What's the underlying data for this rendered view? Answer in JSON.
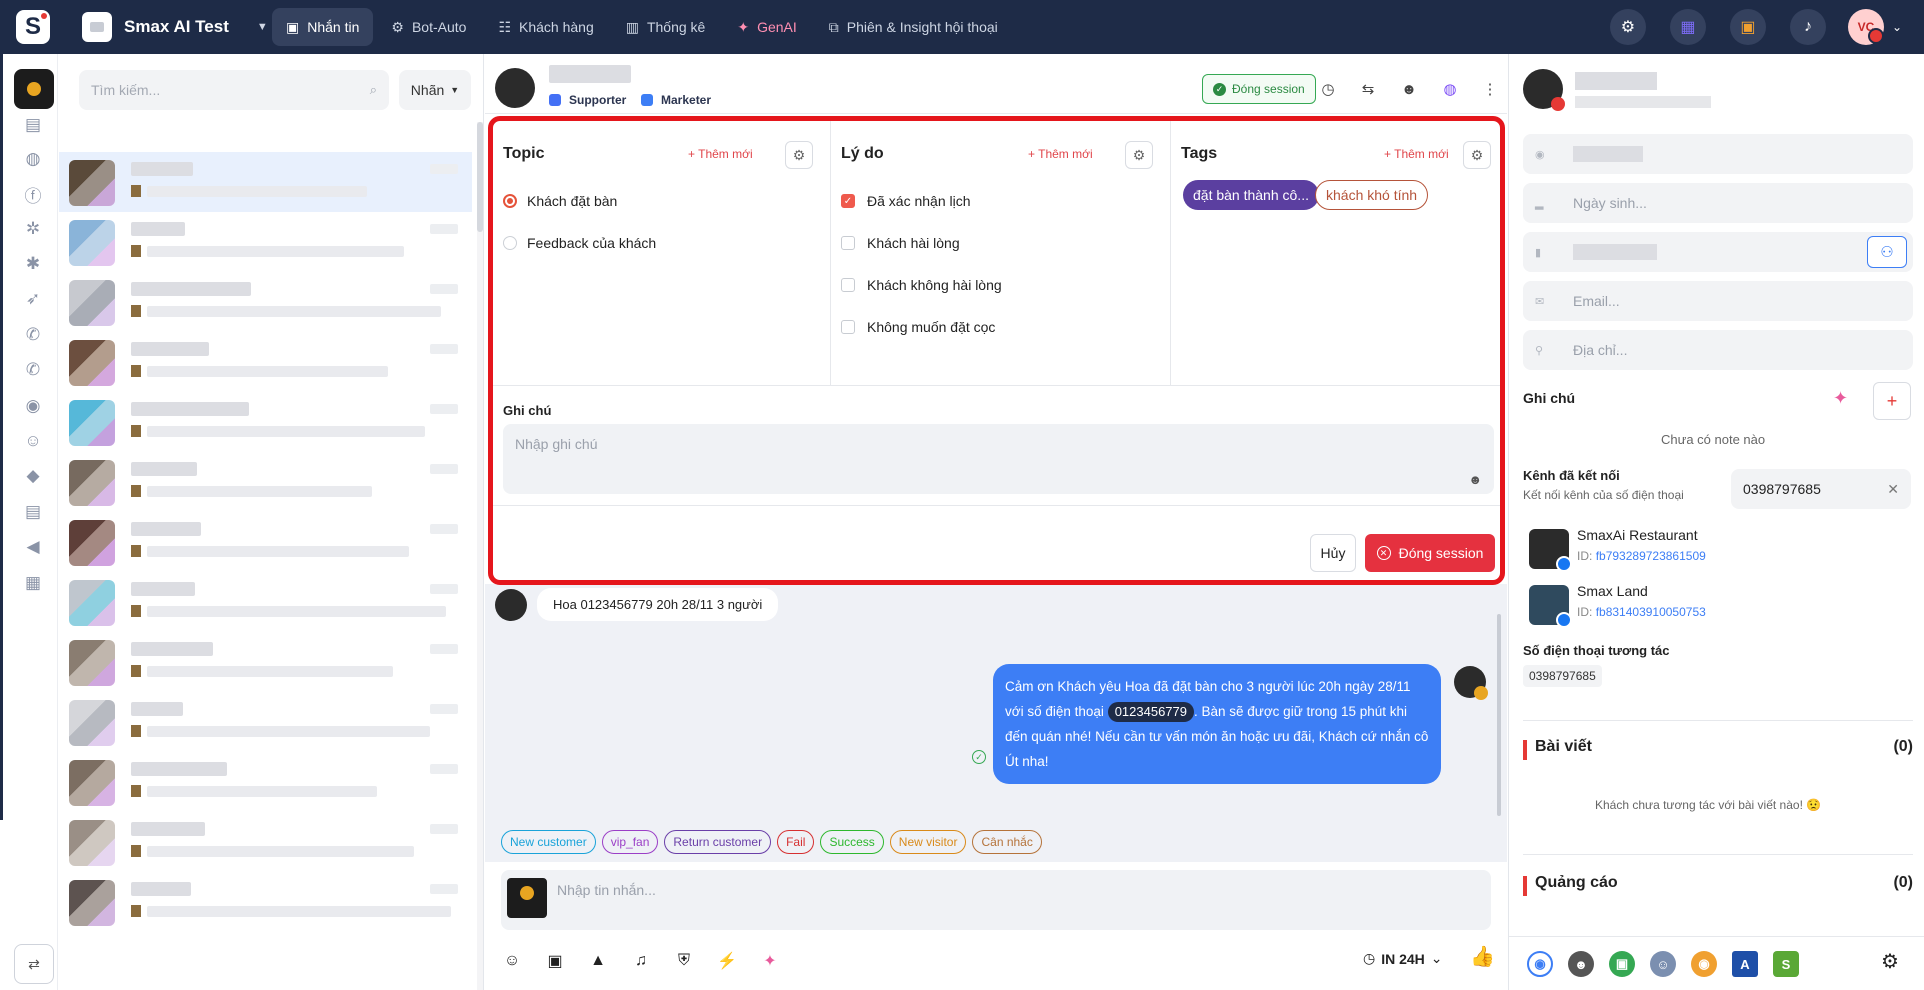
{
  "workspace": {
    "name": "Smax AI Test"
  },
  "nav": [
    {
      "label": "Nhắn tin",
      "icon": "chat-icon",
      "glyph": "▣",
      "active": true
    },
    {
      "label": "Bot-Auto",
      "icon": "bot-icon",
      "glyph": "⚙",
      "active": false
    },
    {
      "label": "Khách hàng",
      "icon": "contacts-icon",
      "glyph": "☷",
      "active": false
    },
    {
      "label": "Thống kê",
      "icon": "chart-icon",
      "glyph": "▥",
      "active": false
    },
    {
      "label": "GenAI",
      "icon": "sparkle-icon",
      "glyph": "✦",
      "active": false
    },
    {
      "label": "Phiên & Insight hội thoại",
      "icon": "insight-icon",
      "glyph": "⧉",
      "active": false
    }
  ],
  "user": {
    "initials": "VC"
  },
  "conversations": {
    "search_placeholder": "Tìm kiếm...",
    "label_filter": "Nhãn"
  },
  "chat": {
    "roles": [
      "Supporter",
      "Marketer"
    ],
    "close_session_label": "Đóng session",
    "incoming_message": "Hoa 0123456779 20h 28/11 3 người",
    "outgoing_message_part1": "Cảm ơn Khách yêu Hoa đã đặt bàn cho 3 người lúc 20h ngày 28/11 với số điện thoại",
    "outgoing_phone": "0123456779",
    "outgoing_message_part2": ". Bàn sẽ được giữ trong 15 phút khi đến quán nhé! Nếu cần tư vấn món ăn hoặc ưu đãi, Khách cứ nhắn cô Út nha!",
    "quick_tags": [
      {
        "label": "New customer",
        "color": "#1aa3d9"
      },
      {
        "label": "vip_fan",
        "color": "#9b3fc7"
      },
      {
        "label": "Return customer",
        "color": "#6a3fa8"
      },
      {
        "label": "Fail",
        "color": "#d63031"
      },
      {
        "label": "Success",
        "color": "#2eb82e"
      },
      {
        "label": "New visitor",
        "color": "#d98a1a"
      },
      {
        "label": "Cân nhắc",
        "color": "#b5733a"
      }
    ],
    "composer_placeholder": "Nhập tin nhắn...",
    "reply_window": "IN 24H"
  },
  "session_panel": {
    "add_new_label": "+ Thêm mới",
    "topic": {
      "title": "Topic",
      "options": [
        {
          "label": "Khách đặt bàn",
          "selected": true
        },
        {
          "label": "Feedback của khách",
          "selected": false
        }
      ]
    },
    "reason": {
      "title": "Lý do",
      "options": [
        {
          "label": "Đã xác nhận lịch",
          "checked": true
        },
        {
          "label": "Khách hài lòng",
          "checked": false
        },
        {
          "label": "Khách không hài lòng",
          "checked": false
        },
        {
          "label": "Không muốn đặt cọc",
          "checked": false
        }
      ]
    },
    "tags": {
      "title": "Tags",
      "items": [
        {
          "label": "đặt bàn thành cô...",
          "style": "filled",
          "color": "#5b3fa0"
        },
        {
          "label": "khách khó tính",
          "style": "outline",
          "color": "#b5543a"
        }
      ]
    },
    "note_label": "Ghi chú",
    "note_placeholder": "Nhập ghi chú",
    "cancel_label": "Hủy",
    "close_label": "Đóng session"
  },
  "info": {
    "birthday_placeholder": "Ngày sinh...",
    "email_placeholder": "Email...",
    "address_placeholder": "Địa chỉ...",
    "note_title": "Ghi chú",
    "note_empty": "Chưa có note nào",
    "channels_title": "Kênh đã kết nối",
    "channels_sub": "Kết nối kênh của số điện thoại",
    "phone_value": "0398797685",
    "pages": [
      {
        "name": "SmaxAi Restaurant",
        "id_label": "ID:",
        "id": "fb793289723861509"
      },
      {
        "name": "Smax Land",
        "id_label": "ID:",
        "id": "fb831403910050753"
      }
    ],
    "phones_title": "Số điện thoại tương tác",
    "phone_chip": "0398797685",
    "posts_title": "Bài viết",
    "posts_count": "(0)",
    "posts_empty": "Khách chưa tương tác với bài viết nào! 😟",
    "ads_title": "Quảng cáo",
    "ads_count": "(0)"
  }
}
